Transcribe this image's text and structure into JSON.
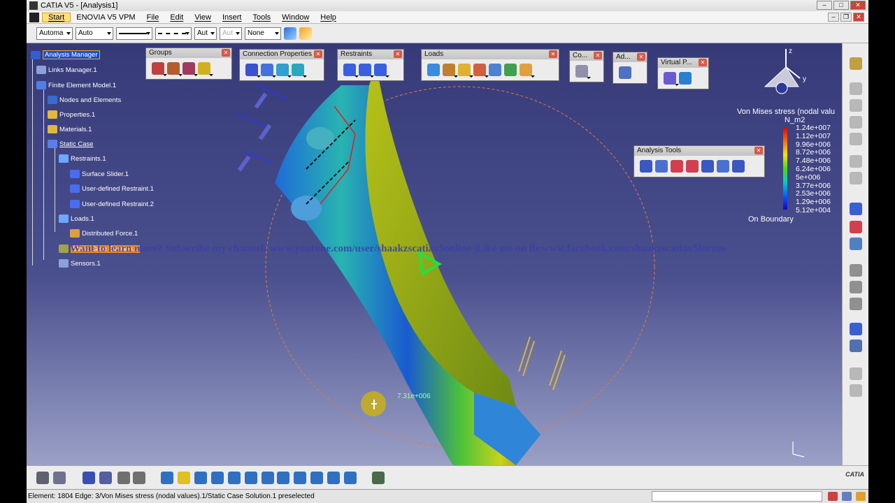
{
  "window": {
    "title": "CATIA V5 - [Analysis1]"
  },
  "menu": {
    "items": [
      "Start",
      "ENOVIA V5 VPM",
      "File",
      "Edit",
      "View",
      "Insert",
      "Tools",
      "Window",
      "Help"
    ]
  },
  "properties_bar": {
    "fill_color": "Automa",
    "transparency": "Auto",
    "line_weight": "Aut",
    "line_weight_disabled": "Aut",
    "layer": "None"
  },
  "tree": {
    "items": [
      {
        "label": "Analysis Manager"
      },
      {
        "label": "Links Manager.1"
      },
      {
        "label": "Finite Element Model.1"
      },
      {
        "label": "Nodes and Elements"
      },
      {
        "label": "Properties.1"
      },
      {
        "label": "Materials.1"
      },
      {
        "label": "Static Case"
      },
      {
        "label": "Restraints.1"
      },
      {
        "label": "Surface Slider.1"
      },
      {
        "label": "User-defined Restraint.1"
      },
      {
        "label": "User-defined Restraint.2"
      },
      {
        "label": "Loads.1"
      },
      {
        "label": "Distributed Force.1"
      },
      {
        "label": "Static Case Solution.1"
      },
      {
        "label": "Sensors.1"
      }
    ]
  },
  "toolbars": {
    "groups": "Groups",
    "connection": "Connection Properties",
    "restraints": "Restraints",
    "loads": "Loads",
    "co": "Co...",
    "ad": "Ad...",
    "virtual": "Virtual P...",
    "analysis_tools": "Analysis Tools"
  },
  "banner": "Want to learn more? Subscribe my channel: www.youtube.com/user/shaakzscatiav5online |Like me on fb:www.facebook.com/shaakzscatiav5forum",
  "legend": {
    "title": "Von Mises stress (nodal valu",
    "unit": "N_m2",
    "values": [
      "1.24e+007",
      "1.12e+007",
      "9.96e+006",
      "8.72e+006",
      "7.48e+006",
      "6.24e+006",
      "5e+006",
      "3.77e+006",
      "2.53e+006",
      "1.29e+006",
      "5.12e+004"
    ],
    "footer": "On Boundary"
  },
  "annotation": "7.31e+006",
  "axis_labels": {
    "z": "z",
    "y": "y"
  },
  "status": {
    "text": "Element: 1804 Edge: 3/Von Mises stress (nodal values).1/Static Case Solution.1 preselected"
  },
  "brand": "CATIA",
  "colors": {
    "viewport_top": "#363a78",
    "viewport_bottom": "#9aa0c6",
    "highlight": "#1c4fc9",
    "highlight_border": "#ff9e2b"
  }
}
